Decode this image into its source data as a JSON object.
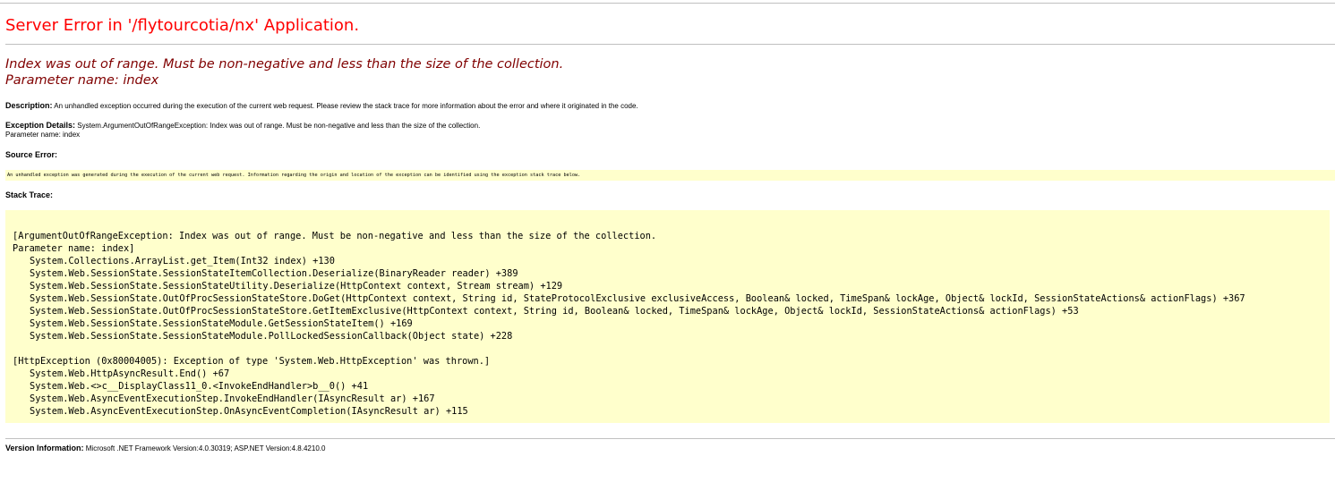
{
  "title": "Server Error in '/flytourcotia/nx' Application.",
  "exception_heading": {
    "line1": "Index was out of range. Must be non-negative and less than the size of the collection.",
    "line2": "Parameter name: index"
  },
  "description": {
    "label": "Description:",
    "text": "An unhandled exception occurred during the execution of the current web request. Please review the stack trace for more information about the error and where it originated in the code."
  },
  "exception_details": {
    "label": "Exception Details:",
    "text": "System.ArgumentOutOfRangeException: Index was out of range. Must be non-negative and less than the size of the collection.",
    "line2": "Parameter name: index"
  },
  "source_error": {
    "label": "Source Error:",
    "text": "An unhandled exception was generated during the execution of the current web request. Information regarding the origin and location of the exception can be identified using the exception stack trace below."
  },
  "stack_trace": {
    "label": "Stack Trace:",
    "lines": [
      "[ArgumentOutOfRangeException: Index was out of range. Must be non-negative and less than the size of the collection.",
      "Parameter name: index]",
      "System.Collections.ArrayList.get_Item(Int32 index) +130",
      "System.Web.SessionState.SessionStateItemCollection.Deserialize(BinaryReader reader) +389",
      "System.Web.SessionState.SessionStateUtility.Deserialize(HttpContext context, Stream stream) +129",
      "System.Web.SessionState.OutOfProcSessionStateStore.DoGet(HttpContext context, String id, StateProtocolExclusive exclusiveAccess, Boolean& locked, TimeSpan& lockAge, Object& lockId, SessionStateActions& actionFlags) +367",
      "System.Web.SessionState.OutOfProcSessionStateStore.GetItemExclusive(HttpContext context, String id, Boolean& locked, TimeSpan& lockAge, Object& lockId, SessionStateActions& actionFlags) +53",
      "System.Web.SessionState.SessionStateModule.GetSessionStateItem() +169",
      "System.Web.SessionState.SessionStateModule.PollLockedSessionCallback(Object state) +228",
      "",
      "[HttpException (0x80004005): Exception of type 'System.Web.HttpException' was thrown.]",
      "System.Web.HttpAsyncResult.End() +67",
      "System.Web.<>c__DisplayClass11_0.<InvokeEndHandler>b__0() +41",
      "System.Web.AsyncEventExecutionStep.InvokeEndHandler(IAsyncResult ar) +167",
      "System.Web.AsyncEventExecutionStep.OnAsyncEventCompletion(IAsyncResult ar) +115"
    ],
    "indented": [
      false,
      false,
      true,
      true,
      true,
      true,
      true,
      true,
      true,
      false,
      false,
      true,
      true,
      true,
      true
    ]
  },
  "version_info": {
    "label": "Version Information:",
    "text": "Microsoft .NET Framework Version:4.0.30319; ASP.NET Version:4.8.4210.0"
  }
}
